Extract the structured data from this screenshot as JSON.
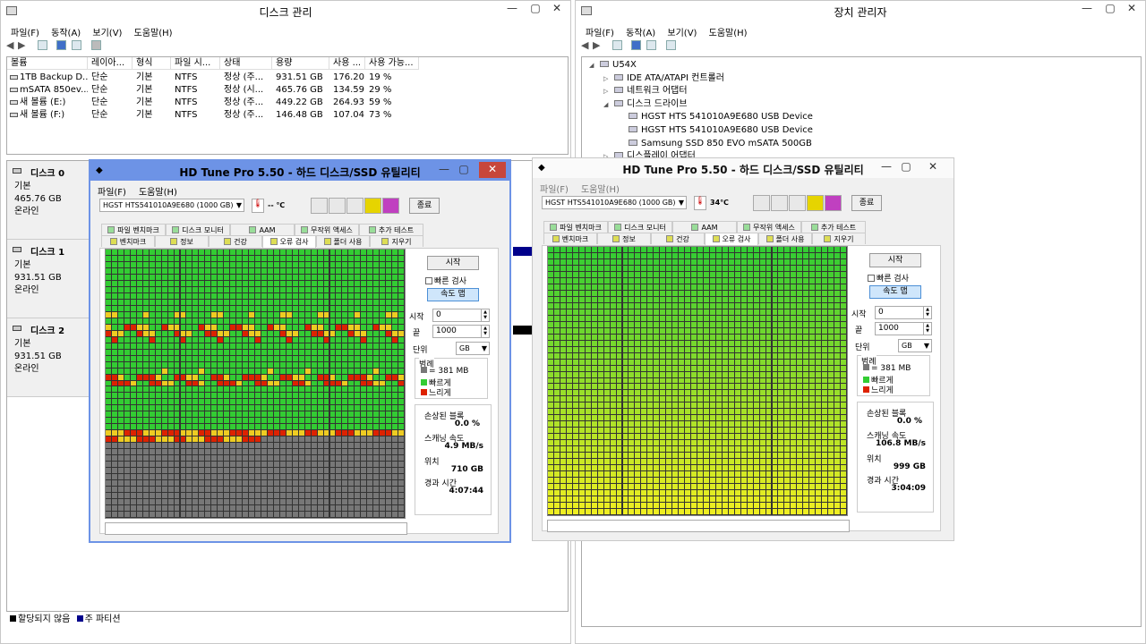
{
  "diskmgmt": {
    "title": "디스크 관리",
    "menu": [
      "파일(F)",
      "동작(A)",
      "보기(V)",
      "도움말(H)"
    ],
    "columns": [
      "볼륨",
      "레이아...",
      "형식",
      "파일 시...",
      "상태",
      "용량",
      "사용 ...",
      "사용 가능..."
    ],
    "volumes": [
      [
        "1TB Backup D...",
        "단순",
        "기본",
        "NTFS",
        "정상 (주...",
        "931.51 GB",
        "176.20...",
        "19 %"
      ],
      [
        "mSATA 850ev...",
        "단순",
        "기본",
        "NTFS",
        "정상 (시...",
        "465.76 GB",
        "134.59...",
        "29 %"
      ],
      [
        "새 볼륨 (E:)",
        "단순",
        "기본",
        "NTFS",
        "정상 (주...",
        "449.22 GB",
        "264.93...",
        "59 %"
      ],
      [
        "새 볼륨 (F:)",
        "단순",
        "기본",
        "NTFS",
        "정상 (주...",
        "146.48 GB",
        "107.04...",
        "73 %"
      ]
    ],
    "disks": [
      {
        "name": "디스크 0",
        "type": "기본",
        "size": "465.76 GB",
        "status": "온라인"
      },
      {
        "name": "디스크 1",
        "type": "기본",
        "size": "931.51 GB",
        "status": "온라인"
      },
      {
        "name": "디스크 2",
        "type": "기본",
        "size": "931.51 GB",
        "status": "온라인"
      }
    ],
    "legend": {
      "unallocated": "할당되지 않음",
      "primary": "주 파티션"
    }
  },
  "devmgr": {
    "title": "장치 관리자",
    "menu": [
      "파일(F)",
      "동작(A)",
      "보기(V)",
      "도움말(H)"
    ],
    "tree": [
      {
        "label": "U54X",
        "level": 0,
        "exp": "◢"
      },
      {
        "label": "IDE ATA/ATAPI 컨트롤러",
        "level": 1,
        "exp": "▷"
      },
      {
        "label": "네트워크 어댑터",
        "level": 1,
        "exp": "▷"
      },
      {
        "label": "디스크 드라이브",
        "level": 1,
        "exp": "◢"
      },
      {
        "label": "HGST HTS 541010A9E680 USB Device",
        "level": 2,
        "exp": ""
      },
      {
        "label": "HGST HTS 541010A9E680 USB Device",
        "level": 2,
        "exp": ""
      },
      {
        "label": "Samsung SSD 850 EVO mSATA 500GB",
        "level": 2,
        "exp": ""
      },
      {
        "label": "디스플레이 어댑터",
        "level": 1,
        "exp": "▷"
      }
    ]
  },
  "hdtune1": {
    "title": "HD Tune Pro 5.50 - 하드 디스크/SSD 유틸리티",
    "menu": [
      "파일(F)",
      "도움말(H)"
    ],
    "drive": "HGST HTS541010A9E680 (1000 GB)",
    "temp": "-- ℃",
    "exit": "종료",
    "tabs_top": [
      "파일 벤치마크",
      "디스크 모니터",
      "AAM",
      "무작위 액세스",
      "추가 테스트"
    ],
    "tabs_bottom": [
      "벤치마크",
      "정보",
      "건강",
      "오류 검사",
      "폴더 사용",
      "지우기"
    ],
    "start_btn": "시작",
    "quick_scan": "빠른 검사",
    "speed_map": "속도 맵",
    "start_label": "시작",
    "start_val": "0",
    "end_label": "끝",
    "end_val": "1000",
    "unit_label": "단위",
    "unit_val": "GB",
    "legend_title": "범례",
    "legend": [
      "= 381 MB",
      "빠르게",
      "느리게"
    ],
    "damaged_label": "손상된 블록",
    "damaged_val": "0.0 %",
    "speed_label": "스캐닝 속도",
    "speed_val": "4.9 MB/s",
    "pos_label": "위치",
    "pos_val": "710 GB",
    "elapsed_label": "경과 시간",
    "elapsed_val": "4:07:44",
    "progress": 0.71
  },
  "hdtune2": {
    "title": "HD Tune Pro 5.50 - 하드 디스크/SSD 유틸리티",
    "menu": [
      "파일(F)",
      "도움말(H)"
    ],
    "drive": "HGST HTS541010A9E680 (1000 GB)",
    "temp": "34℃",
    "exit": "종료",
    "tabs_top": [
      "파일 벤치마크",
      "디스크 모니터",
      "AAM",
      "무작위 액세스",
      "추가 테스트"
    ],
    "tabs_bottom": [
      "벤치마크",
      "정보",
      "건강",
      "오류 검사",
      "폴더 사용",
      "지우기"
    ],
    "start_btn": "시작",
    "quick_scan": "빠른 검사",
    "speed_map": "속도 맵",
    "start_label": "시작",
    "start_val": "0",
    "end_label": "끝",
    "end_val": "1000",
    "unit_label": "단위",
    "unit_val": "GB",
    "legend_title": "범례",
    "legend": [
      "= 381 MB",
      "빠르게",
      "느리게"
    ],
    "damaged_label": "손상된 블록",
    "damaged_val": "0.0 %",
    "speed_label": "스캐닝 속도",
    "speed_val": "106.8 MB/s",
    "pos_label": "위치",
    "pos_val": "999 GB",
    "elapsed_label": "경과 시간",
    "elapsed_val": "3:04:09",
    "progress": 1.0
  },
  "colors": {
    "fast": "#33cc33",
    "slow": "#dd2200",
    "mid": "#eecc22",
    "pending": "#777777",
    "accent": "#6d93e6"
  }
}
